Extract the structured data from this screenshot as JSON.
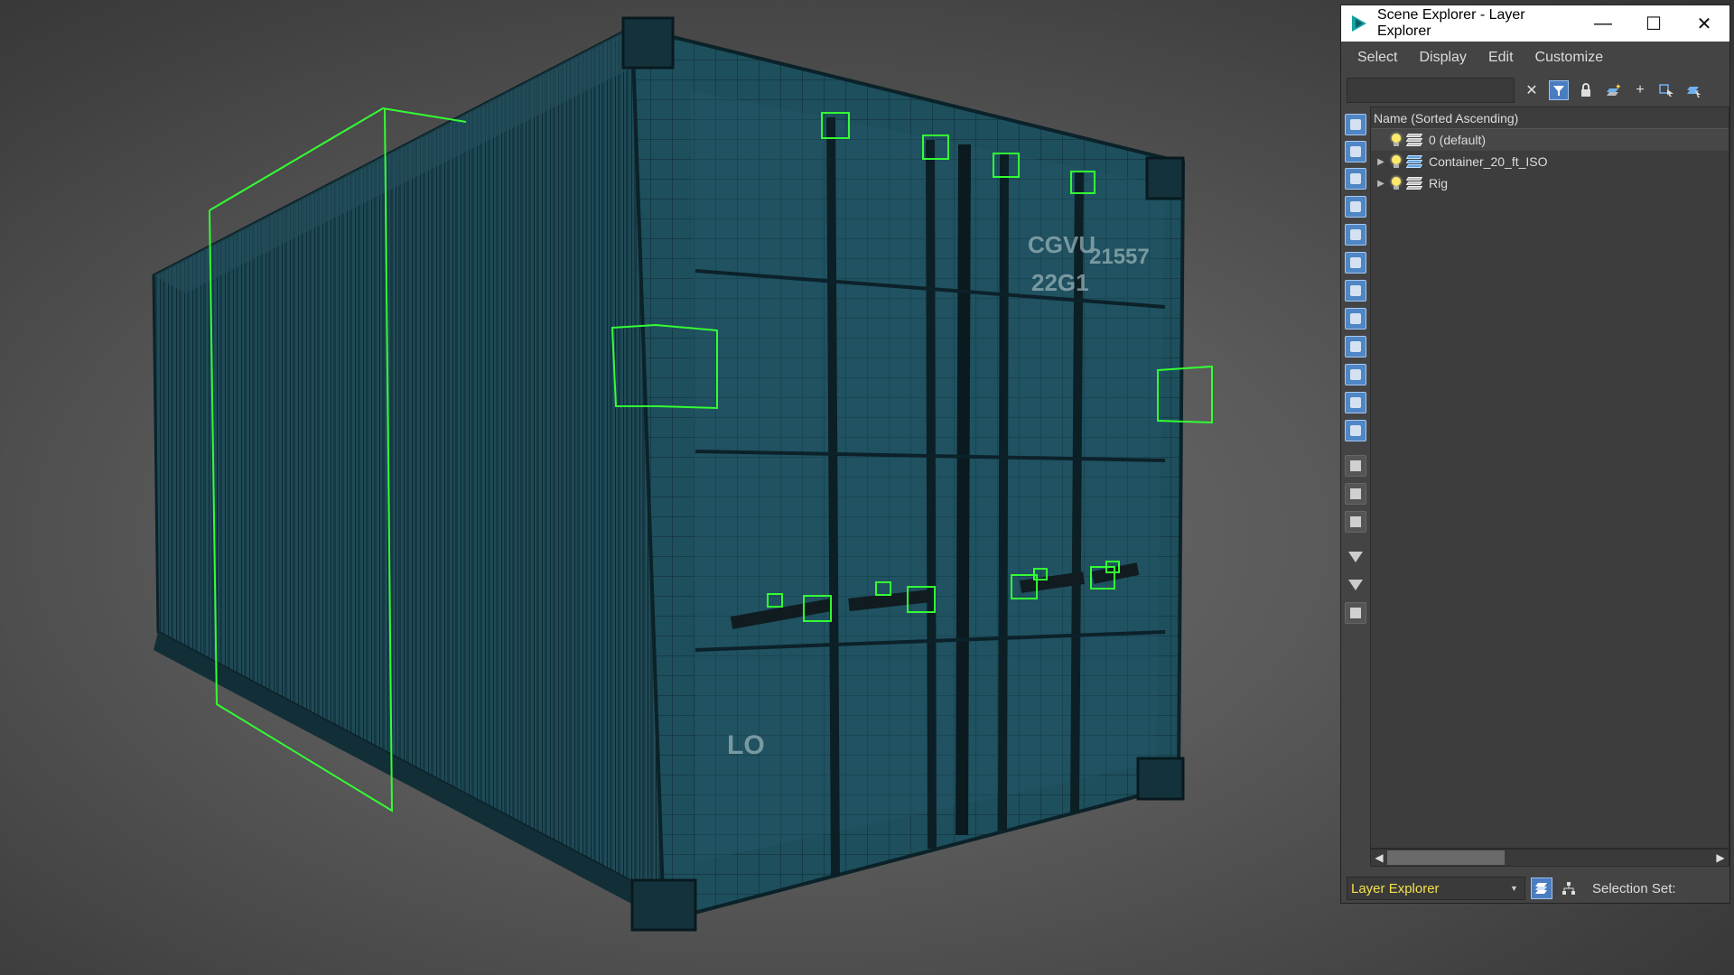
{
  "window": {
    "title": "Scene Explorer - Layer Explorer",
    "minimize_glyph": "—",
    "maximize_glyph": "☐",
    "close_glyph": "✕"
  },
  "menu": [
    "Select",
    "Display",
    "Edit",
    "Customize"
  ],
  "toolbar": {
    "search_value": "",
    "icons": [
      "clear-search-icon",
      "filter-toggle-icon",
      "lock-icon",
      "create-layer-icon",
      "add-to-layer-icon",
      "select-layer-objects-icon",
      "set-current-layer-icon"
    ]
  },
  "tree": {
    "column_header": "Name (Sorted Ascending)",
    "rows": [
      {
        "name": "0 (default)",
        "expandable": false,
        "layer_color": "gray"
      },
      {
        "name": "Container_20_ft_ISO",
        "expandable": true,
        "layer_color": "blue"
      },
      {
        "name": "Rig",
        "expandable": true,
        "layer_color": "gray"
      }
    ]
  },
  "footer": {
    "explorer_label": "Layer Explorer",
    "selection_set_label": "Selection Set:"
  },
  "colors": {
    "accent_blue": "#4f86c6",
    "explorer_label_yellow": "#f4e04d",
    "selection_green": "#33ff33",
    "container_teal": "#1f4f5e"
  }
}
